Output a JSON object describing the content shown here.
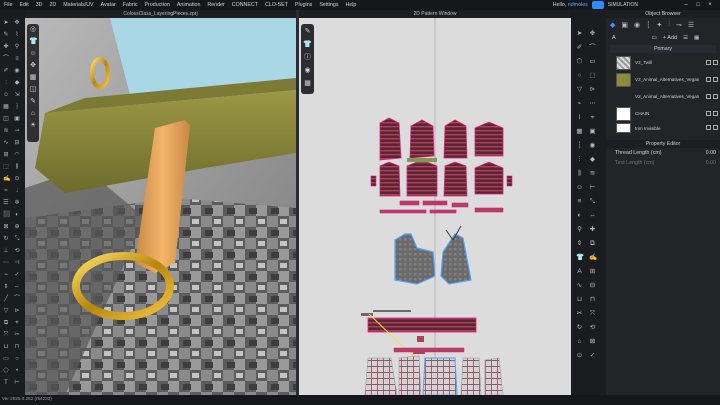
{
  "menu": [
    "File",
    "Edit",
    "3D",
    "2D",
    "Materials/UV",
    "Avatar",
    "Fabric",
    "Production",
    "Animation",
    "Render",
    "CONNECT",
    "CLO-SET",
    "Plugins",
    "Settings",
    "Help"
  ],
  "header": {
    "greeting": "Hello, ",
    "username": "ndmoles",
    "mode_label": "SIMULATION",
    "window_controls": [
      "–",
      "□",
      "×"
    ]
  },
  "viewport3d": {
    "title": "ColossClass_LayeringPieces.zprj"
  },
  "pattern_window": {
    "title": "2D Pattern Window"
  },
  "object_browser": {
    "title": "Object Browser",
    "add_label": "+ Add",
    "section": "Primary",
    "items": [
      {
        "name": "V2_Twill"
      },
      {
        "name": "V2_Animal_Alternatives_Vegan"
      },
      {
        "name": "V2_Animal_Alternatives_Vegan"
      },
      {
        "name": "CHAIN"
      },
      {
        "name": "trim Invisible"
      }
    ]
  },
  "property_editor": {
    "title": "Property Editor",
    "rows": [
      {
        "label": "Thread Length (cm)",
        "value": "0.00"
      },
      {
        "label": "Text Length (cm)",
        "value": "0.00"
      }
    ]
  },
  "status_bar": {
    "text": "Ver 2025.0.252 (r54233)"
  },
  "colors": {
    "accent": "#2f8cff",
    "belt": "#8c8a3c",
    "loop": "#e8a45c",
    "ring": "#d4a017",
    "shirt": "#a8d8e8",
    "pattern_bg": "#dcdcdc",
    "seam": "#e0207a",
    "pattern_selected": "#4da3ff"
  }
}
